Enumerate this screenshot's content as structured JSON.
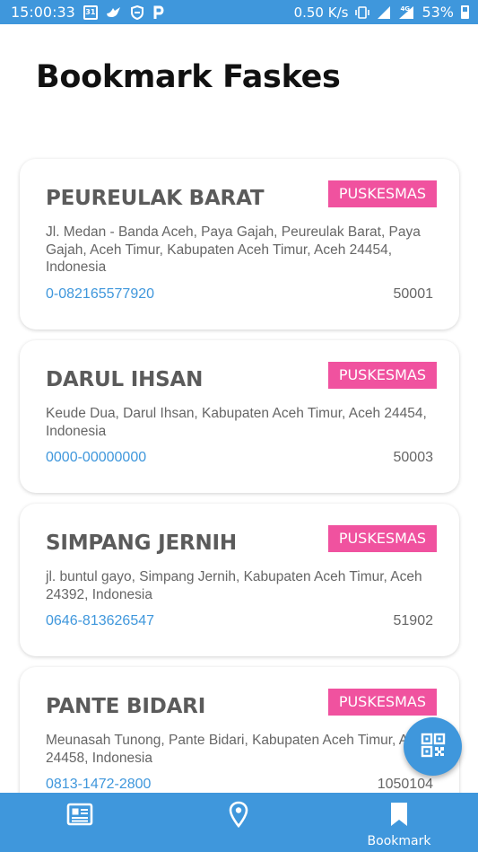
{
  "status_bar": {
    "time": "15:00:33",
    "calendar_day": "31",
    "net_speed": "0.50 K/s",
    "network": "4G",
    "battery": "53%"
  },
  "page": {
    "title": "Bookmark Faskes"
  },
  "facilities": [
    {
      "name": "PEUREULAK BARAT",
      "type": "PUSKESMAS",
      "address": "Jl. Medan - Banda Aceh, Paya Gajah, Peureulak Barat, Paya Gajah, Aceh Timur, Kabupaten Aceh Timur, Aceh 24454, Indonesia",
      "phone": "0-082165577920",
      "code": "50001"
    },
    {
      "name": "DARUL IHSAN",
      "type": "PUSKESMAS",
      "address": "Keude Dua, Darul Ihsan, Kabupaten Aceh Timur, Aceh 24454, Indonesia",
      "phone": "0000-00000000",
      "code": "50003"
    },
    {
      "name": "SIMPANG JERNIH",
      "type": "PUSKESMAS",
      "address": "jl. buntul gayo, Simpang Jernih, Kabupaten Aceh Timur, Aceh 24392, Indonesia",
      "phone": "0646-813626547",
      "code": "51902"
    },
    {
      "name": "PANTE BIDARI",
      "type": "PUSKESMAS",
      "address": "Meunasah Tunong, Pante Bidari, Kabupaten Aceh Timur, Aceh 24458, Indonesia",
      "phone": "0813-1472-2800",
      "code": "1050104"
    }
  ],
  "fab": {
    "icon": "qr-code-icon"
  },
  "bottom_nav": {
    "items": [
      {
        "icon": "news-icon",
        "label": ""
      },
      {
        "icon": "map-pin-icon",
        "label": ""
      },
      {
        "icon": "bookmark-icon",
        "label": "Bookmark"
      }
    ],
    "active_index": 2
  },
  "colors": {
    "primary": "#3f97dc",
    "badge": "#f0529f"
  }
}
